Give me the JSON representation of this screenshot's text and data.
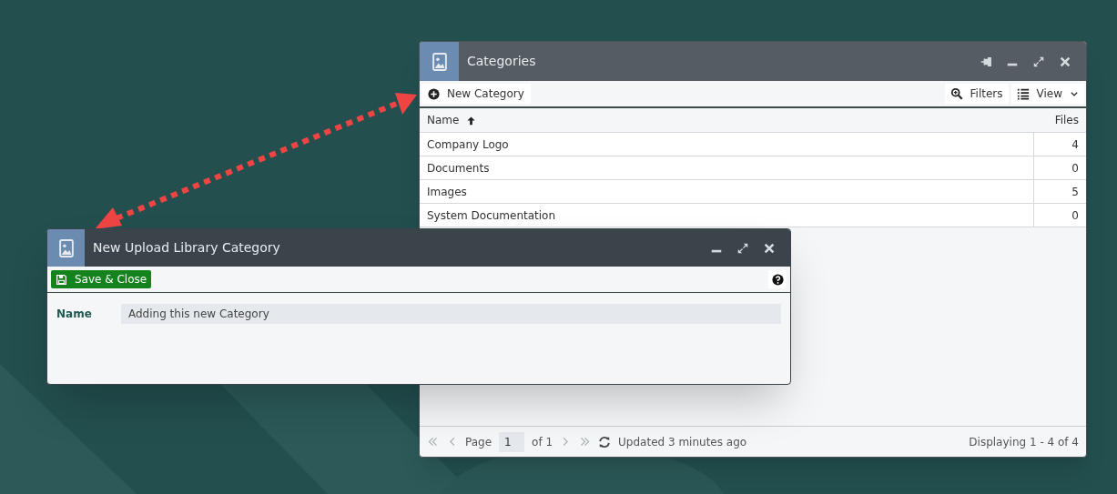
{
  "categories_window": {
    "title": "Categories",
    "toolbar": {
      "new_button": "New Category",
      "filters_button": "Filters",
      "view_button": "View"
    },
    "columns": [
      "Name",
      "Files"
    ],
    "rows": [
      {
        "name": "Company Logo",
        "files": "4"
      },
      {
        "name": "Documents",
        "files": "0"
      },
      {
        "name": "Images",
        "files": "5"
      },
      {
        "name": "System Documentation",
        "files": "0"
      }
    ],
    "pager": {
      "page_label": "Page",
      "page": "1",
      "of": "of 1",
      "updated": "Updated 3 minutes ago",
      "displaying": "Displaying 1 - 4 of 4"
    }
  },
  "dialog": {
    "title": "New Upload Library Category",
    "save_button": "Save & Close",
    "fields": [
      {
        "label": "Name",
        "value": "Adding this new Category"
      }
    ]
  }
}
